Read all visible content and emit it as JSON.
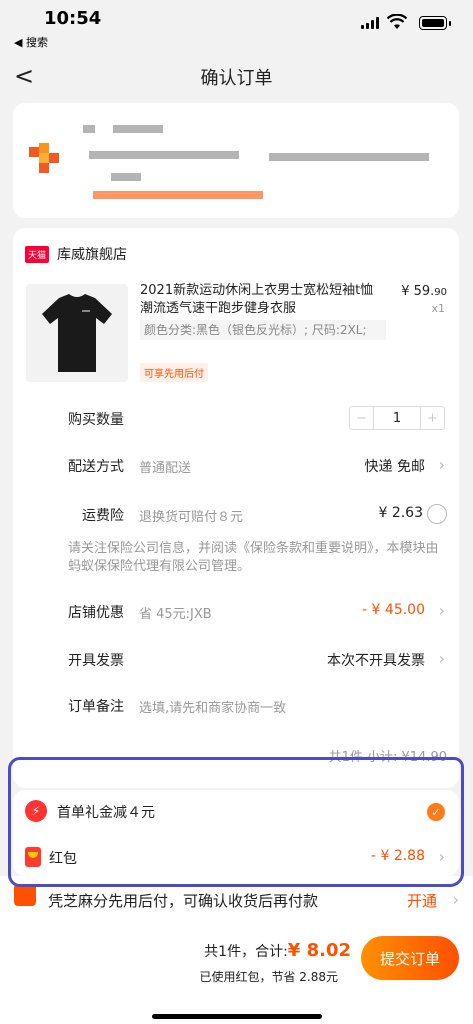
{
  "status": {
    "time": "10:54",
    "back_app": "◀ 搜索"
  },
  "nav": {
    "back": "<",
    "title": "确认订单"
  },
  "shop": {
    "badge": "天猫",
    "name": "库威旗舰店"
  },
  "product": {
    "title": "2021新款运动休闲上衣男士宽松短袖t恤潮流透气速干跑步健身衣服",
    "price_main": "¥ 59.",
    "price_cents": "90",
    "qty": "x1",
    "spec": "颜色分类:黑色（银色反光标）; 尺码:2XL;",
    "tag": "可享先用后付"
  },
  "rows": {
    "quantity_label": "购买数量",
    "quantity_value": "1",
    "delivery_label": "配送方式",
    "delivery_sub": "普通配送",
    "delivery_value": "快递 免邮",
    "insurance_label": "运费险",
    "insurance_sub": "退换货可赔付８元",
    "insurance_value": "¥ 2.63",
    "insurance_note": "请关注保险公司信息，并阅读《保险条款和重要说明》，本模块由蚂蚁保保险代理有限公司管理。",
    "shop_discount_label": "店铺优惠",
    "shop_discount_sub": "省 45元:JXB",
    "shop_discount_value": "- ¥ 45.00",
    "invoice_label": "开具发票",
    "invoice_value": "本次不开具发票",
    "remark_label": "订单备注",
    "remark_placeholder": "选填,请先和商家协商一致",
    "subtotal": "共1件  小计: ¥14.90"
  },
  "coupons": {
    "first_order_icon": "⚡",
    "first_order_label": "首单礼金减４元",
    "first_order_check": "✓",
    "hongbao_label": "红包",
    "hongbao_value": "- ¥ 2.88"
  },
  "paylater": {
    "text": "凭芝麻分先用后付，可确认收货后再付款",
    "action": "开通"
  },
  "bottom": {
    "count": "共1件，",
    "total_label": "合计:",
    "total_amount": "¥ 8.02",
    "saved": "已使用红包，节省 2.88元",
    "submit": "提交订单"
  },
  "colors": {
    "accent": "#ff5000",
    "highlight": "#4a4dc4"
  }
}
